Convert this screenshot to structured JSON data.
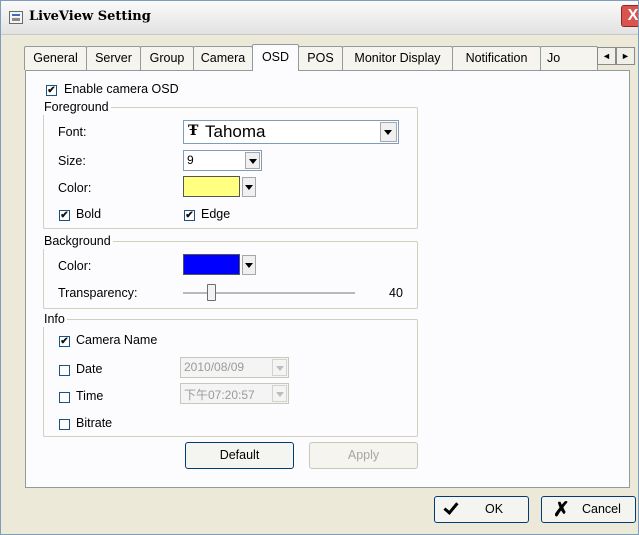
{
  "window": {
    "title": "LiveView Setting",
    "close_glyph": "X"
  },
  "tabs": [
    {
      "label": "General"
    },
    {
      "label": "Server"
    },
    {
      "label": "Group"
    },
    {
      "label": "Camera"
    },
    {
      "label": "OSD",
      "active": true
    },
    {
      "label": "POS"
    },
    {
      "label": "Monitor Display"
    },
    {
      "label": "Notification"
    },
    {
      "label": "Jo"
    }
  ],
  "tab_scroll": {
    "left": "◄",
    "right": "►"
  },
  "osd": {
    "enable_label": "Enable camera OSD",
    "enable_checked": true,
    "foreground": {
      "title": "Foreground",
      "font_label": "Font:",
      "font_icon_glyph": "Ŧ",
      "font_value": "Tahoma",
      "size_label": "Size:",
      "size_value": "9",
      "color_label": "Color:",
      "color_value": "#ffff80",
      "bold_label": "Bold",
      "bold_checked": true,
      "edge_label": "Edge",
      "edge_checked": true
    },
    "background": {
      "title": "Background",
      "color_label": "Color:",
      "color_value": "#0000ff",
      "transparency_label": "Transparency:",
      "transparency_value": "40"
    },
    "info": {
      "title": "Info",
      "camera_name_label": "Camera Name",
      "camera_name_checked": true,
      "date_label": "Date",
      "date_value": "2010/08/09",
      "time_label": "Time",
      "time_value": "下午07:20:57",
      "bitrate_label": "Bitrate"
    },
    "check_glyph": "✔"
  },
  "buttons": {
    "default": "Default",
    "apply": "Apply",
    "ok": "OK",
    "cancel": "Cancel"
  }
}
